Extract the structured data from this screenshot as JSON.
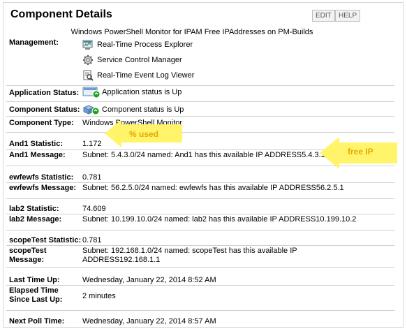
{
  "header": {
    "title": "Component Details",
    "edit_label": "EDIT",
    "help_label": "HELP",
    "subtitle": "Windows PowerShell Monitor for IPAM Free IPAddresses on PM-Builds"
  },
  "management": {
    "label": "Management:",
    "links": [
      {
        "label": "Real-Time Process Explorer",
        "icon": "process-explorer-icon"
      },
      {
        "label": "Service Control Manager",
        "icon": "gear-icon"
      },
      {
        "label": "Real-Time Event Log Viewer",
        "icon": "event-log-icon"
      }
    ]
  },
  "application_status": {
    "label": "Application Status:",
    "value": "Application status is Up"
  },
  "component_status": {
    "label": "Component Status:",
    "value": "Component status is Up"
  },
  "component_type": {
    "label": "Component Type:",
    "value": "Windows PowerShell Monitor"
  },
  "stats": [
    {
      "stat_label": "And1 Statistic:",
      "stat_value": "1.172",
      "msg_label": "And1 Message:",
      "msg_value": "Subnet: 5.4.3.0/24 named: And1 has this available IP ADDRESS5.4.3.1"
    },
    {
      "stat_label": "ewfewfs Statistic:",
      "stat_value": "0.781",
      "msg_label": "ewfewfs Message:",
      "msg_value": "Subnet: 56.2.5.0/24 named: ewfewfs has this available IP ADDRESS56.2.5.1"
    },
    {
      "stat_label": "lab2 Statistic:",
      "stat_value": "74.609",
      "msg_label": "lab2 Message:",
      "msg_value": "Subnet: 10.199.10.0/24 named: lab2 has this available IP ADDRESS10.199.10.2"
    },
    {
      "stat_label": "scopeTest Statistic:",
      "stat_value": "0.781",
      "msg_label_1": "scopeTest",
      "msg_label_2": "Message:",
      "msg_value_1": "Subnet: 192.168.1.0/24 named: scopeTest has this available IP",
      "msg_value_2": "ADDRESS192.168.1.1"
    }
  ],
  "timing": {
    "last_time_up_label": "Last Time Up:",
    "last_time_up_value": "Wednesday, January 22, 2014 8:52 AM",
    "elapsed_label_1": "Elapsed Time",
    "elapsed_label_2": "Since Last Up:",
    "elapsed_value": "2 minutes",
    "next_poll_label": "Next Poll Time:",
    "next_poll_value": "Wednesday, January 22, 2014 8:57 AM"
  },
  "annotations": {
    "used_label": "% used",
    "free_label": "free IP",
    "arrow_color": "#fff46a",
    "text_color": "#e8a800"
  },
  "colors": {
    "status_up": "#1aa31a"
  }
}
